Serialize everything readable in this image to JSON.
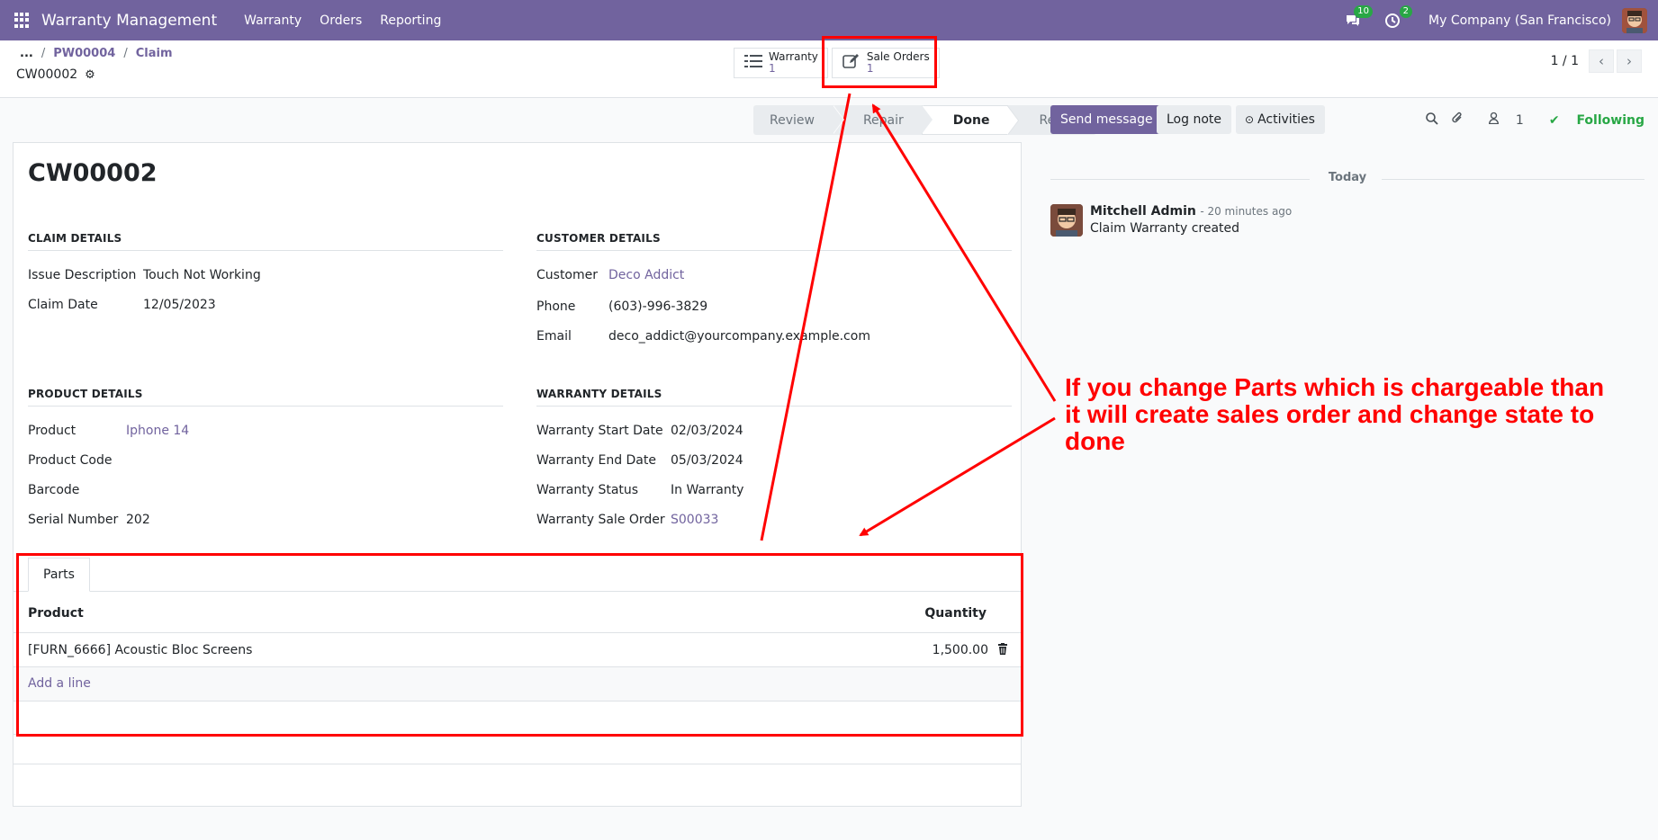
{
  "nav": {
    "app_name": "Warranty Management",
    "menus": [
      "Warranty",
      "Orders",
      "Reporting"
    ],
    "messages_badge": "10",
    "activities_badge": "2",
    "company": "My Company (San Francisco)"
  },
  "control_panel": {
    "breadcrumb_more": "...",
    "breadcrumb_1": "PW00004",
    "breadcrumb_2": "Claim",
    "record_title": "CW00002",
    "smart_buttons": [
      {
        "label": "Warranty",
        "count": "1"
      },
      {
        "label": "Sale Orders",
        "count": "1"
      }
    ],
    "pager": "1 / 1"
  },
  "statusbar": {
    "stages": [
      "Review",
      "Repair",
      "Done",
      "Reject"
    ],
    "active_stage": "Done"
  },
  "form": {
    "name": "CW00002",
    "claim_details": {
      "title": "Claim Details",
      "issue_label": "Issue Description",
      "issue_value": "Touch Not Working",
      "date_label": "Claim Date",
      "date_value": "12/05/2023"
    },
    "customer_details": {
      "title": "Customer Details",
      "customer_label": "Customer",
      "customer_value": "Deco Addict",
      "phone_label": "Phone",
      "phone_value": "(603)-996-3829",
      "email_label": "Email",
      "email_value": "deco_addict@yourcompany.example.com"
    },
    "product_details": {
      "title": "Product Details",
      "product_label": "Product",
      "product_value": "Iphone 14",
      "code_label": "Product Code",
      "barcode_label": "Barcode",
      "serial_label": "Serial Number",
      "serial_value": "202"
    },
    "warranty_details": {
      "title": "Warranty Details",
      "start_label": "Warranty Start Date",
      "start_value": "02/03/2024",
      "end_label": "Warranty End Date",
      "end_value": "05/03/2024",
      "status_label": "Warranty Status",
      "status_value": "In Warranty",
      "so_label": "Warranty Sale Order",
      "so_value": "S00033"
    },
    "parts": {
      "tab_label": "Parts",
      "col_product": "Product",
      "col_quantity": "Quantity",
      "rows": [
        {
          "product": "[FURN_6666] Acoustic Bloc Screens",
          "quantity": "1,500.00"
        }
      ],
      "add_line": "Add a line"
    }
  },
  "chatter": {
    "send_message": "Send message",
    "log_note": "Log note",
    "activities": "Activities",
    "followers_count": "1",
    "following": "Following",
    "date_separator": "Today",
    "message": {
      "author": "Mitchell Admin",
      "time": "- 20 minutes ago",
      "text": "Claim Warranty created"
    }
  },
  "annotation": {
    "text": "If you change Parts which is chargeable than it will create sales order and change state to done",
    "color": "#ff0000"
  },
  "colors": {
    "brand": "#71639e",
    "success": "#28a745"
  }
}
